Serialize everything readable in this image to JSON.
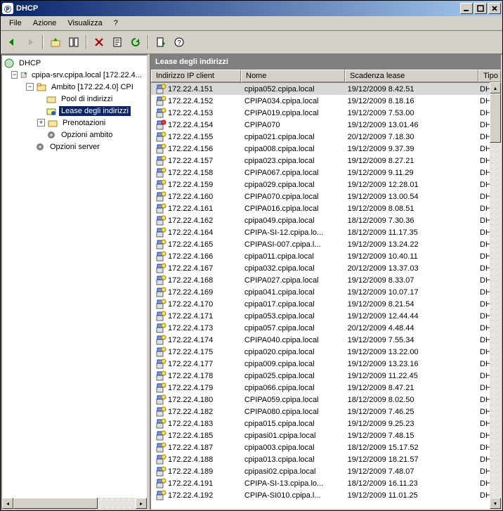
{
  "window": {
    "title": "DHCP"
  },
  "menu": {
    "file": "File",
    "action": "Azione",
    "view": "Visualizza",
    "help": "?"
  },
  "tree": {
    "root": "DHCP",
    "server": "cpipa-srv.cpipa.local [172.22.4...",
    "scope": "Ambito [172.22.4.0] CPI",
    "pool": "Pool di indirizzi",
    "leases": "Lease degli indirizzi",
    "reservations": "Prenotazioni",
    "scope_opts": "Opzioni ambito",
    "server_opts": "Opzioni server"
  },
  "list": {
    "title": "Lease degli indirizzi",
    "headers": {
      "ip": "Indirizzo IP client",
      "name": "Nome",
      "exp": "Scadenza lease",
      "type": "Tipo"
    },
    "rows": [
      {
        "ip": "172.22.4.151",
        "name": "cpipa052.cpipa.local",
        "exp": "19/12/2009 8.42.51",
        "type": "DHCP",
        "selected": true
      },
      {
        "ip": "172.22.4.152",
        "name": "CPIPA034.cpipa.local",
        "exp": "19/12/2009 8.18.16",
        "type": "DHCP"
      },
      {
        "ip": "172.22.4.153",
        "name": "CPIPA019.cpipa.local",
        "exp": "19/12/2009 7.53.00",
        "type": "DHCP"
      },
      {
        "ip": "172.22.4.154",
        "name": "CPIPA070",
        "exp": "19/12/2009 13.01.46",
        "type": "DHCP",
        "alt": true
      },
      {
        "ip": "172.22.4.155",
        "name": "cpipa021.cpipa.local",
        "exp": "20/12/2009 7.18.30",
        "type": "DHCP"
      },
      {
        "ip": "172.22.4.156",
        "name": "cpipa008.cpipa.local",
        "exp": "19/12/2009 9.37.39",
        "type": "DHCP"
      },
      {
        "ip": "172.22.4.157",
        "name": "cpipa023.cpipa.local",
        "exp": "19/12/2009 8.27.21",
        "type": "DHCP"
      },
      {
        "ip": "172.22.4.158",
        "name": "CPIPA067.cpipa.local",
        "exp": "19/12/2009 9.11.29",
        "type": "DHCP"
      },
      {
        "ip": "172.22.4.159",
        "name": "cpipa029.cpipa.local",
        "exp": "19/12/2009 12.28.01",
        "type": "DHCP"
      },
      {
        "ip": "172.22.4.160",
        "name": "CPIPA070.cpipa.local",
        "exp": "19/12/2009 13.00.54",
        "type": "DHCP"
      },
      {
        "ip": "172.22.4.161",
        "name": "CPIPA016.cpipa.local",
        "exp": "19/12/2009 8.08.51",
        "type": "DHCP"
      },
      {
        "ip": "172.22.4.162",
        "name": "cpipa049.cpipa.local",
        "exp": "18/12/2009 7.30.36",
        "type": "DHCP"
      },
      {
        "ip": "172.22.4.164",
        "name": "CPIPA-SI-12.cpipa.lo...",
        "exp": "18/12/2009 11.17.35",
        "type": "DHCP"
      },
      {
        "ip": "172.22.4.165",
        "name": "CPIPASI-007.cpipa.l...",
        "exp": "19/12/2009 13.24.22",
        "type": "DHCP"
      },
      {
        "ip": "172.22.4.166",
        "name": "cpipa011.cpipa.local",
        "exp": "19/12/2009 10.40.11",
        "type": "DHCP"
      },
      {
        "ip": "172.22.4.167",
        "name": "cpipa032.cpipa.local",
        "exp": "20/12/2009 13.37.03",
        "type": "DHCP"
      },
      {
        "ip": "172.22.4.168",
        "name": "CPIPA027.cpipa.local",
        "exp": "19/12/2009 8.33.07",
        "type": "DHCP"
      },
      {
        "ip": "172.22.4.169",
        "name": "cpipa041.cpipa.local",
        "exp": "19/12/2009 10.07.17",
        "type": "DHCP"
      },
      {
        "ip": "172.22.4.170",
        "name": "cpipa017.cpipa.local",
        "exp": "19/12/2009 8.21.54",
        "type": "DHCP"
      },
      {
        "ip": "172.22.4.171",
        "name": "cpipa053.cpipa.local",
        "exp": "19/12/2009 12.44.44",
        "type": "DHCP"
      },
      {
        "ip": "172.22.4.173",
        "name": "cpipa057.cpipa.local",
        "exp": "20/12/2009 4.48.44",
        "type": "DHCP"
      },
      {
        "ip": "172.22.4.174",
        "name": "CPIPA040.cpipa.local",
        "exp": "19/12/2009 7.55.34",
        "type": "DHCP"
      },
      {
        "ip": "172.22.4.175",
        "name": "cpipa020.cpipa.local",
        "exp": "19/12/2009 13.22.00",
        "type": "DHCP"
      },
      {
        "ip": "172.22.4.177",
        "name": "cpipa009.cpipa.local",
        "exp": "19/12/2009 13.23.16",
        "type": "DHCP"
      },
      {
        "ip": "172.22.4.178",
        "name": "cpipa025.cpipa.local",
        "exp": "19/12/2009 11.22.45",
        "type": "DHCP"
      },
      {
        "ip": "172.22.4.179",
        "name": "cpipa066.cpipa.local",
        "exp": "19/12/2009 8.47.21",
        "type": "DHCP"
      },
      {
        "ip": "172.22.4.180",
        "name": "CPIPA059.cpipa.local",
        "exp": "18/12/2009 8.02.50",
        "type": "DHCP"
      },
      {
        "ip": "172.22.4.182",
        "name": "CPIPA080.cpipa.local",
        "exp": "19/12/2009 7.46.25",
        "type": "DHCP"
      },
      {
        "ip": "172.22.4.183",
        "name": "cpipa015.cpipa.local",
        "exp": "19/12/2009 9.25.23",
        "type": "DHCP"
      },
      {
        "ip": "172.22.4.185",
        "name": "cpipasi01.cpipa.local",
        "exp": "19/12/2009 7.48.15",
        "type": "DHCP"
      },
      {
        "ip": "172.22.4.187",
        "name": "cpipa003.cpipa.local",
        "exp": "18/12/2009 15.17.52",
        "type": "DHCP"
      },
      {
        "ip": "172.22.4.188",
        "name": "cpipa013.cpipa.local",
        "exp": "19/12/2009 18.21.57",
        "type": "DHCP"
      },
      {
        "ip": "172.22.4.189",
        "name": "cpipasi02.cpipa.local",
        "exp": "19/12/2009 7.48.07",
        "type": "DHCP"
      },
      {
        "ip": "172.22.4.191",
        "name": "CPIPA-SI-13.cpipa.lo...",
        "exp": "18/12/2009 16.11.23",
        "type": "DHCP"
      },
      {
        "ip": "172.22.4.192",
        "name": "CPIPA-SI010.cpipa.l...",
        "exp": "19/12/2009 11.01.25",
        "type": "DHCP"
      }
    ]
  }
}
